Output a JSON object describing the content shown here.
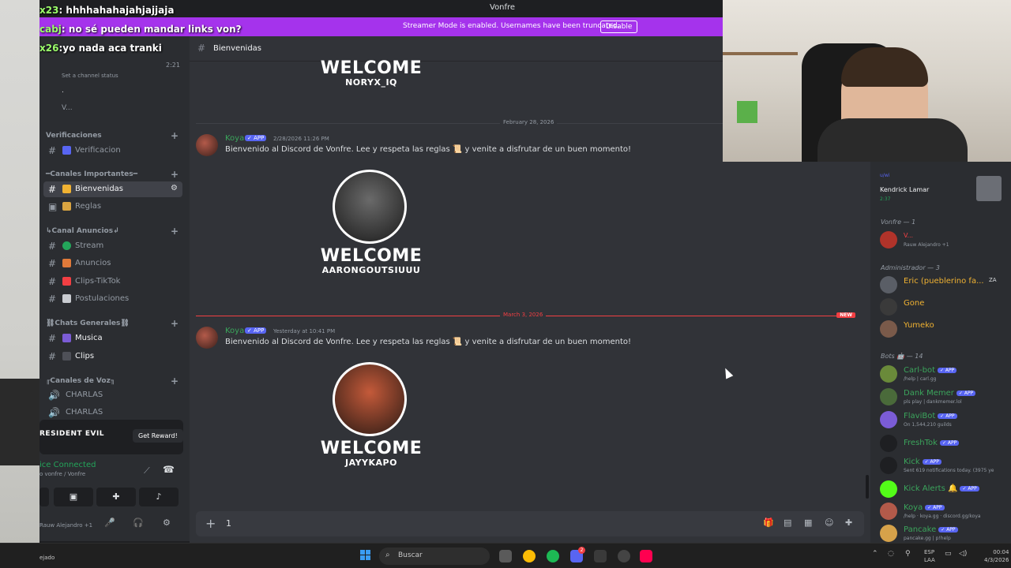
{
  "window": {
    "title": "Vonfre"
  },
  "banner": {
    "message": "Streamer Mode is enabled. Usernames have been truncated.",
    "button": "Disable"
  },
  "overlay_chat": [
    {
      "user": "x23",
      "text": ": hhhhahahajahjajjaja"
    },
    {
      "user": "cabj",
      "text": ": no sé pueden mandar links von?"
    },
    {
      "user": "x26",
      "text": ":yo nada aca tranki"
    }
  ],
  "sidebar": {
    "voice_user_time": "2:21",
    "voice_status_placeholder": "Set a channel status",
    "voice_members": [
      ".",
      "V..."
    ],
    "categories": [
      {
        "label": "Verificaciones",
        "channels": [
          {
            "label": "Verificacion"
          }
        ]
      },
      {
        "label": "━Canales Importantes━",
        "channels": [
          {
            "label": "Bienvenidas"
          },
          {
            "label": "Reglas"
          }
        ]
      },
      {
        "label": "↳Canal Anuncios↲",
        "channels": [
          {
            "label": "Stream"
          },
          {
            "label": "Anuncios"
          },
          {
            "label": "Clips-TikTok"
          },
          {
            "label": "Postulaciones"
          }
        ]
      },
      {
        "label": "⛓Chats Generales⛓",
        "channels": [
          {
            "label": "Musica"
          },
          {
            "label": "Clips"
          }
        ]
      },
      {
        "label": "╓Canales de Voz╖",
        "channels": [
          {
            "label": "CHARLAS"
          },
          {
            "label": "CHARLAS"
          }
        ]
      }
    ],
    "reward": {
      "game": "RESIDENT EVIL",
      "button": "Get Reward!"
    },
    "voice": {
      "status": "ice Connected",
      "location": "o vonfre / Vonfre"
    },
    "userbar": {
      "activity": "Rauw Alejandro +1"
    }
  },
  "main": {
    "channel_name": "Bienvenidas",
    "top_welcome": {
      "title": "WELCOME",
      "name": "NORYX_IQ"
    },
    "dividers": [
      {
        "label": "February 28, 2026"
      },
      {
        "label": "March 3, 2026",
        "tag": "NEW"
      }
    ],
    "messages": [
      {
        "author": "Koya",
        "app": "✓ APP",
        "time": "2/28/2026 11:26 PM",
        "text": "Bienvenido al Discord de Vonfre. Lee y respeta las reglas 📜 y venite a disfrutar de un buen momento!",
        "welcome": {
          "title": "WELCOME",
          "name": "AARONGOUTSIUUU"
        }
      },
      {
        "author": "Koya",
        "app": "✓ APP",
        "time": "Yesterday at 10:41 PM",
        "text": "Bienvenido al Discord de Vonfre. Lee y respeta las reglas 📜 y venite a disfrutar de un buen momento!",
        "welcome": {
          "title": "WELCOME",
          "name": "JAYYKAPO"
        }
      }
    ],
    "composer_value": "1"
  },
  "members": {
    "now_playing": {
      "artist": "Kendrick Lamar",
      "label": "u/wi",
      "time": "2:37"
    },
    "groups": [
      {
        "label": "Vonfre — 1",
        "items": [
          {
            "name": "V...",
            "sub": "Rauw Alejandro +1"
          }
        ]
      },
      {
        "label": "Administrador — 3",
        "items": [
          {
            "name": "Eric (pueblerino fa...",
            "tag": "ZA"
          },
          {
            "name": "Gone"
          },
          {
            "name": "Yumeko"
          }
        ]
      },
      {
        "label": "Bots 🤖 — 14",
        "items": [
          {
            "name": "Carl-bot",
            "app": "✓ APP",
            "sub": "/help | carl.gg"
          },
          {
            "name": "Dank Memer",
            "app": "✓ APP",
            "sub": "pls play | dankmemer.lol"
          },
          {
            "name": "FlaviBot",
            "app": "✓ APP",
            "sub": "On 1,544,210 guilds"
          },
          {
            "name": "FreshTok",
            "app": "✓ APP"
          },
          {
            "name": "Kick",
            "app": "✓ APP",
            "sub": "Sent 619 notifications today. (3975 ye"
          },
          {
            "name": "Kick Alerts 🔔",
            "app": "✓ APP"
          },
          {
            "name": "Koya",
            "app": "✓ APP",
            "sub": "/help · koya.gg · discord.gg/koya"
          },
          {
            "name": "Pancake",
            "app": "✓ APP",
            "sub": "pancake.gg | p!help"
          }
        ]
      }
    ]
  },
  "taskbar": {
    "left_text": "ejado",
    "search": "Buscar",
    "lang": "ESP",
    "lang_sub": "LAA",
    "time": "00:04",
    "date": "4/3/2026",
    "badge": "2"
  },
  "colors": {
    "banner": "#a533ec",
    "online": "#23a55a",
    "app_badge": "#5865f2",
    "new": "#f23f43"
  }
}
